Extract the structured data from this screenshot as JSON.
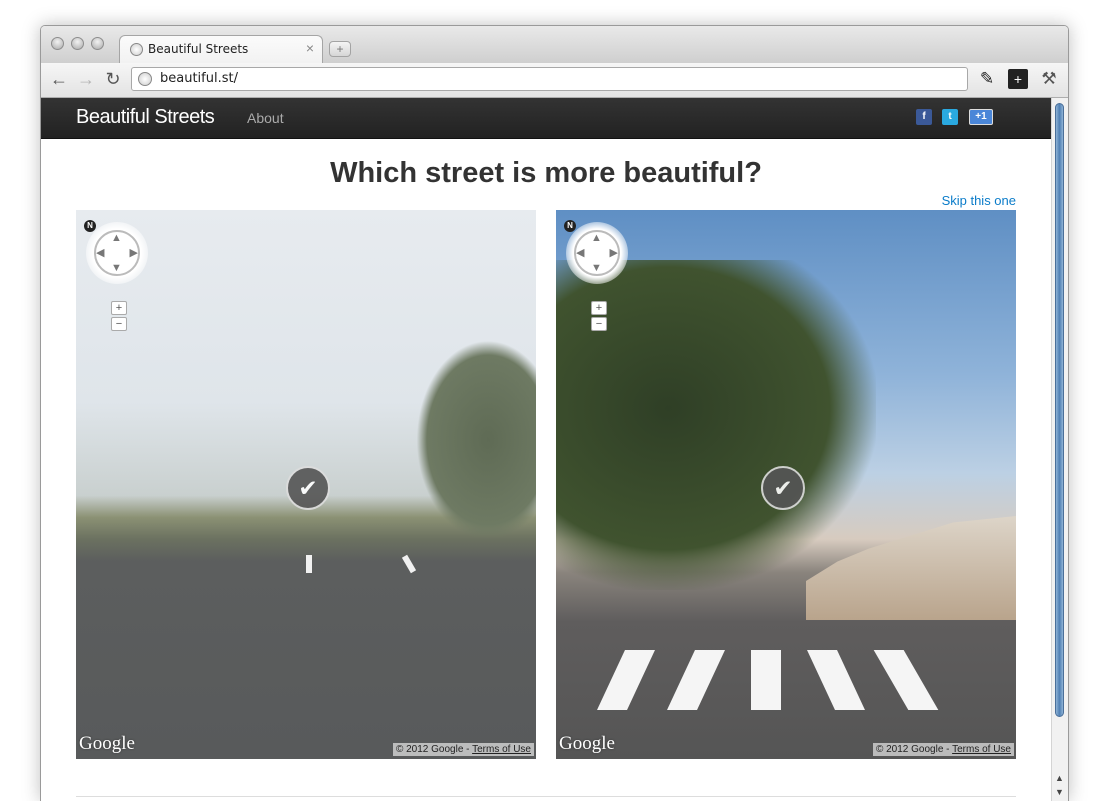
{
  "browser": {
    "tab_title": "Beautiful Streets",
    "new_tab_label": "+",
    "url": "beautiful.st/"
  },
  "nav": {
    "brand": "Beautiful Streets",
    "about": "About",
    "social": {
      "facebook": "f",
      "twitter": "t",
      "plusone": "+1"
    }
  },
  "main": {
    "heading": "Which street is more beautiful?",
    "skip": "Skip this one"
  },
  "panoramas": [
    {
      "logo": "Google",
      "copyright": "© 2012 Google - ",
      "terms": "Terms of Use",
      "compass_n": "N",
      "zoom_in": "+",
      "zoom_out": "−",
      "check": "✔"
    },
    {
      "logo": "Google",
      "copyright": "© 2012 Google - ",
      "terms": "Terms of Use",
      "compass_n": "N",
      "zoom_in": "+",
      "zoom_out": "−",
      "check": "✔"
    }
  ],
  "colors": {
    "navbar": "#222222",
    "link": "#0b7cc9",
    "facebook": "#3b5998",
    "twitter": "#2aa9e0",
    "plusone": "#4a86d8"
  }
}
